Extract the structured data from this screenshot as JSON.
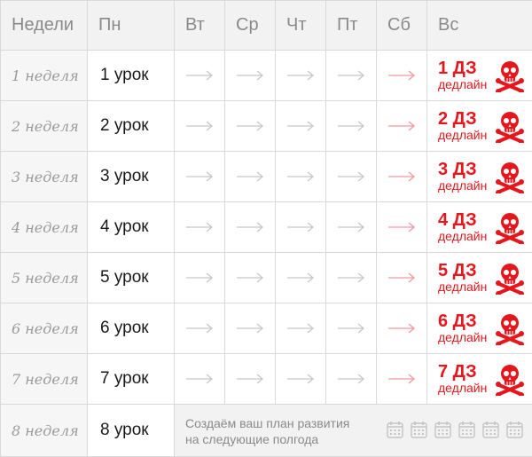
{
  "header": {
    "weeks": "Недели",
    "mon": "Пн",
    "tue": "Вт",
    "wed": "Ср",
    "thu": "Чт",
    "fri": "Пт",
    "sat": "Сб",
    "sun": "Вс"
  },
  "rows": [
    {
      "week": "1 неделя",
      "lesson": "1 урок",
      "homework": "1 ДЗ",
      "deadline": "дедлайн"
    },
    {
      "week": "2 неделя",
      "lesson": "2 урок",
      "homework": "2 ДЗ",
      "deadline": "дедлайн"
    },
    {
      "week": "3 неделя",
      "lesson": "3 урок",
      "homework": "3 ДЗ",
      "deadline": "дедлайн"
    },
    {
      "week": "4 неделя",
      "lesson": "4 урок",
      "homework": "4 ДЗ",
      "deadline": "дедлайн"
    },
    {
      "week": "5 неделя",
      "lesson": "5 урок",
      "homework": "5 ДЗ",
      "deadline": "дедлайн"
    },
    {
      "week": "6 неделя",
      "lesson": "6 урок",
      "homework": "6 ДЗ",
      "deadline": "дедлайн"
    },
    {
      "week": "7 неделя",
      "lesson": "7 урок",
      "homework": "7 ДЗ",
      "deadline": "дедлайн"
    }
  ],
  "last_row": {
    "week": "8 неделя",
    "lesson": "8 урок",
    "plan_line1": "Создаём ваш план развития",
    "plan_line2": "на следующие полгода",
    "calendar_icons": [
      "calendar-icon",
      "calendar-icon",
      "calendar-icon",
      "calendar-icon",
      "calendar-icon",
      "calendar-icon"
    ]
  },
  "icons": {
    "arrow": "arrow-right-icon",
    "deadline": "skull-crossbones-icon"
  },
  "colors": {
    "deadline_red": "#e5161c",
    "arrow_gray": "#c8c8c8",
    "arrow_pink": "#f29aa0",
    "header_bg": "#f2f2f2",
    "muted_text": "#8a8a8a"
  }
}
